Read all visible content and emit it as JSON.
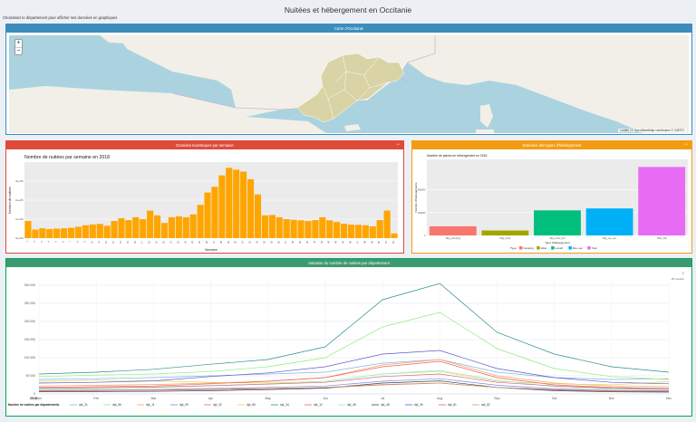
{
  "page": {
    "title": "Nuitées et hébergement en Occitanie",
    "subtitle": "Choisissez le département pour afficher ses données en graphiques"
  },
  "map_box": {
    "title": "Carte d'Occitanie",
    "zoom_in": "+",
    "zoom_out": "−",
    "attribution": "Leaflet | © OpenStreetMap contributors © CARTO",
    "colors": {
      "water": "#aad3df",
      "land": "#f2efe9",
      "region": "#d9d3a5"
    }
  },
  "bar_box": {
    "title": "Données touristiques par semaine",
    "minimize": "−",
    "accent": "#dd4b39"
  },
  "heb_box": {
    "title": "Données des types d'hébergement",
    "minimize": "−",
    "accent": "#f39c12"
  },
  "line_box": {
    "title": "Variation du nombre de nuitées par département",
    "minimize": "−",
    "accent": "#3d9970",
    "legend_title": "Nombre de nuitées par départements",
    "range_label": "25 octobre",
    "year_label": "2018"
  },
  "chart_data": [
    {
      "type": "bar",
      "title": "Nombre de nuitées par semaine en 2018",
      "xlabel": "Semaine",
      "ylabel": "Nombre de nuitées",
      "categories": [
        "1",
        "2",
        "3",
        "4",
        "5",
        "6",
        "7",
        "8",
        "9",
        "10",
        "11",
        "12",
        "13",
        "14",
        "15",
        "16",
        "17",
        "18",
        "19",
        "20",
        "21",
        "22",
        "23",
        "24",
        "25",
        "26",
        "27",
        "28",
        "29",
        "30",
        "31",
        "32",
        "33",
        "34",
        "35",
        "36",
        "37",
        "38",
        "39",
        "40",
        "41",
        "42",
        "43",
        "44",
        "45",
        "46",
        "47",
        "48",
        "49",
        "50",
        "51",
        "52"
      ],
      "values": [
        90000,
        45000,
        52000,
        48000,
        50000,
        52000,
        55000,
        60000,
        68000,
        72000,
        75000,
        65000,
        90000,
        105000,
        95000,
        110000,
        100000,
        145000,
        120000,
        80000,
        110000,
        115000,
        110000,
        125000,
        175000,
        240000,
        270000,
        330000,
        370000,
        360000,
        350000,
        310000,
        230000,
        120000,
        122000,
        110000,
        100000,
        97000,
        94000,
        90000,
        95000,
        110000,
        94000,
        85000,
        76000,
        71000,
        70000,
        68000,
        62000,
        95000,
        145000,
        25000
      ],
      "yticks": [
        "0e+00",
        "1e+05",
        "2e+05",
        "3e+05"
      ],
      "ylim": [
        0,
        400000
      ],
      "color": "#ffa500"
    },
    {
      "type": "bar",
      "title": "Nombre de places en hébergement en 2018",
      "xlabel": "Type d'hébergement",
      "ylabel": "Nombre d'hébergements",
      "categories": [
        "Nbg_camping",
        "Nbg_hotel",
        "Nbg_hotel_tou",
        "Nbg_res_sec",
        "Totel_heb"
      ],
      "values": [
        120000,
        65000,
        330000,
        355000,
        900000
      ],
      "yticks": [
        "0",
        "300000",
        "600000"
      ],
      "ylim": [
        0,
        1000000
      ],
      "legend_title": "Type",
      "legend": [
        "Camping",
        "Hôtel",
        "Locatif",
        "Rés. sec",
        "Total"
      ],
      "colors": [
        "#f8766d",
        "#a3a500",
        "#00bf7d",
        "#00b0f6",
        "#e76bf3"
      ]
    },
    {
      "type": "line",
      "x": [
        "Jan",
        "Feb",
        "Mar",
        "Apr",
        "May",
        "Jun",
        "Jul",
        "Aug",
        "Sep",
        "Oct",
        "Nov",
        "Dec"
      ],
      "yticks": [
        "0",
        "50 000",
        "100 000",
        "150 000",
        "200 000",
        "250 000",
        "300 000"
      ],
      "ylim": [
        0,
        320000
      ],
      "series": [
        {
          "name": "dpt_31",
          "color": "#7cb5ec",
          "values": [
            40000,
            42000,
            45000,
            50000,
            55000,
            60000,
            85000,
            95000,
            60000,
            45000,
            40000,
            42000
          ]
        },
        {
          "name": "dpt_66",
          "color": "#90ed7d",
          "values": [
            48000,
            52000,
            55000,
            62000,
            75000,
            100000,
            185000,
            225000,
            125000,
            70000,
            48000,
            40000
          ]
        },
        {
          "name": "dpt_11",
          "color": "#f7a35c",
          "values": [
            22000,
            24000,
            26000,
            30000,
            35000,
            45000,
            80000,
            95000,
            50000,
            30000,
            22000,
            20000
          ]
        },
        {
          "name": "dpt_09",
          "color": "#8085e9",
          "values": [
            10000,
            11000,
            12000,
            15000,
            18000,
            22000,
            35000,
            42000,
            24000,
            14000,
            10000,
            9000
          ]
        },
        {
          "name": "dpt_32",
          "color": "#f15c80",
          "values": [
            8000,
            9000,
            10000,
            12000,
            14000,
            17000,
            25000,
            30000,
            18000,
            11000,
            8000,
            7000
          ]
        },
        {
          "name": "dpt_65",
          "color": "#e4d354",
          "values": [
            35000,
            38000,
            36000,
            32000,
            30000,
            35000,
            55000,
            62000,
            35000,
            28000,
            25000,
            34000
          ]
        },
        {
          "name": "dpt_34",
          "color": "#2b908f",
          "values": [
            55000,
            60000,
            68000,
            82000,
            95000,
            130000,
            260000,
            305000,
            170000,
            110000,
            75000,
            60000
          ]
        },
        {
          "name": "dpt_12",
          "color": "#f45b5b",
          "values": [
            18000,
            20000,
            22000,
            28000,
            35000,
            45000,
            75000,
            90000,
            45000,
            25000,
            18000,
            15000
          ]
        },
        {
          "name": "dpt_46",
          "color": "#91e8e1",
          "values": [
            14000,
            15000,
            17000,
            22000,
            28000,
            35000,
            55000,
            65000,
            38000,
            20000,
            14000,
            12000
          ]
        },
        {
          "name": "dpt_48",
          "color": "#434348",
          "values": [
            6000,
            6500,
            7000,
            9000,
            12000,
            16000,
            30000,
            36000,
            18000,
            9000,
            6000,
            5000
          ]
        },
        {
          "name": "dpt_30",
          "color": "#5c5ccc",
          "values": [
            30000,
            32000,
            36000,
            48000,
            58000,
            75000,
            110000,
            120000,
            70000,
            45000,
            32000,
            28000
          ]
        },
        {
          "name": "dpt_81",
          "color": "#d06a6a",
          "values": [
            16000,
            17000,
            19000,
            23000,
            27000,
            32000,
            48000,
            55000,
            32000,
            22000,
            16000,
            14000
          ]
        },
        {
          "name": "dpt_82",
          "color": "#c0a060",
          "values": [
            9000,
            10000,
            11000,
            13000,
            15000,
            18000,
            26000,
            30000,
            18000,
            12000,
            9000,
            8000
          ]
        }
      ]
    }
  ]
}
